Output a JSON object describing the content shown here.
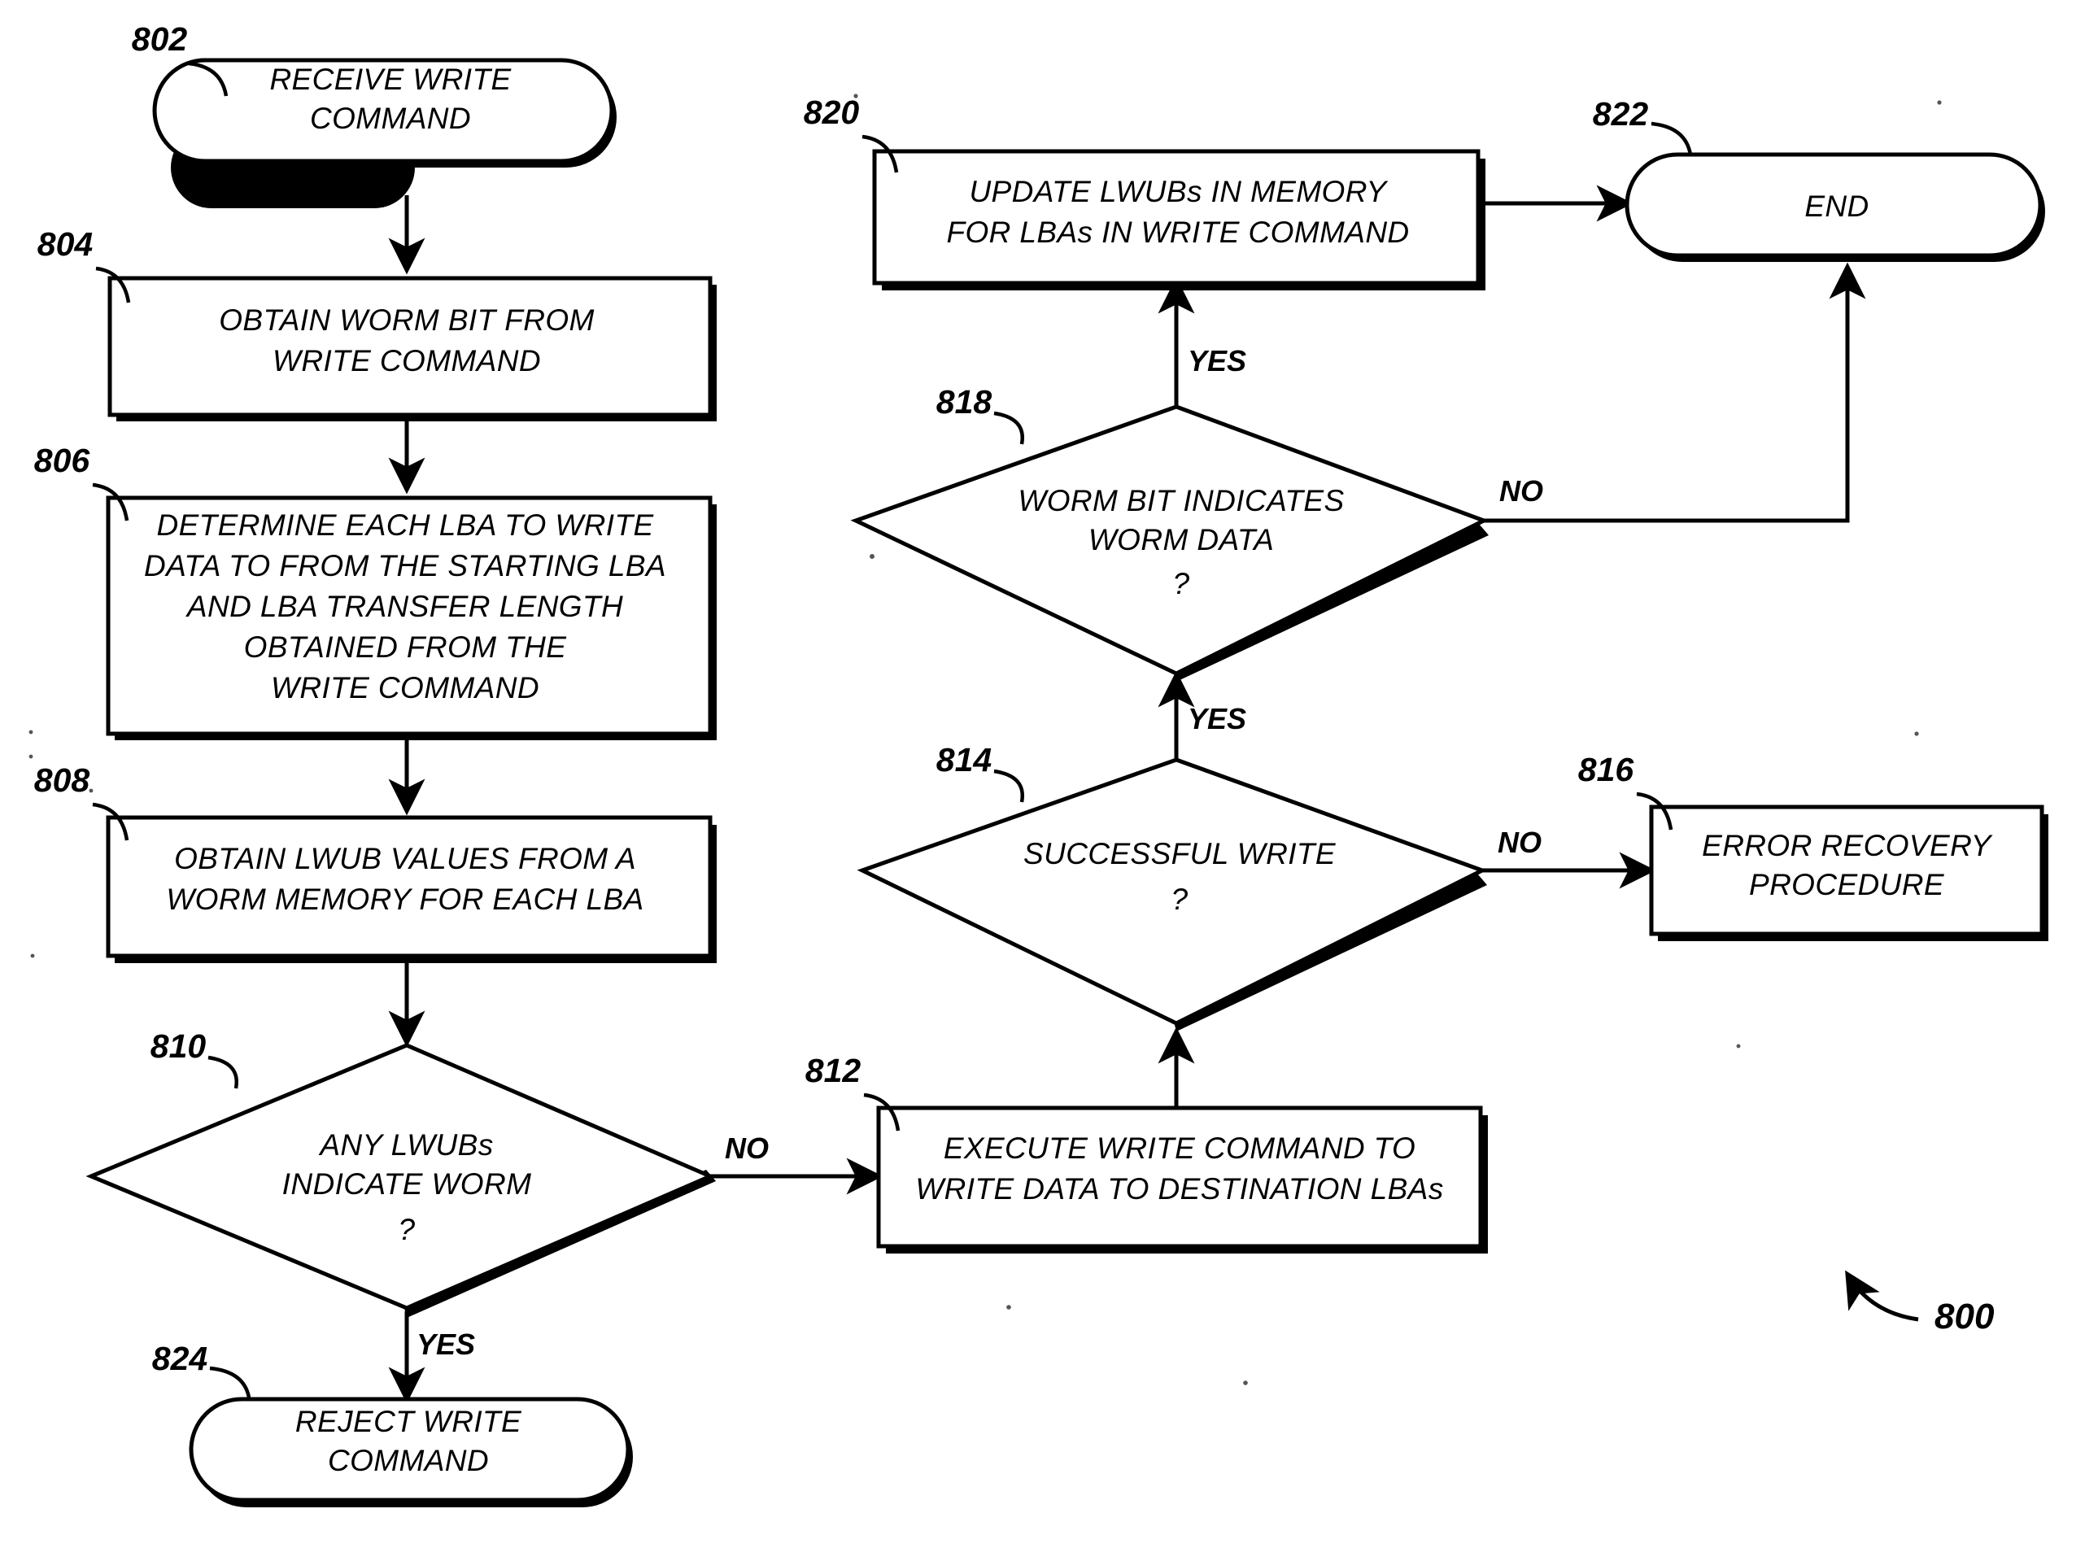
{
  "figure": {
    "number": "800",
    "title": "Write command WORM processing flowchart"
  },
  "nodes": [
    {
      "id": "802",
      "ref": "802",
      "shape": "terminator",
      "lines": [
        "RECEIVE WRITE",
        "COMMAND"
      ]
    },
    {
      "id": "804",
      "ref": "804",
      "shape": "process",
      "lines": [
        "OBTAIN WORM BIT FROM",
        "WRITE COMMAND"
      ]
    },
    {
      "id": "806",
      "ref": "806",
      "shape": "process",
      "lines": [
        "DETERMINE EACH LBA TO WRITE",
        "DATA TO FROM THE STARTING LBA",
        "AND LBA TRANSFER LENGTH",
        "OBTAINED FROM THE",
        "WRITE COMMAND"
      ]
    },
    {
      "id": "808",
      "ref": "808",
      "shape": "process",
      "lines": [
        "OBTAIN LWUB VALUES FROM A",
        "WORM MEMORY FOR EACH LBA"
      ]
    },
    {
      "id": "810",
      "ref": "810",
      "shape": "decision",
      "lines": [
        "ANY LWUBs",
        "INDICATE WORM",
        "?"
      ]
    },
    {
      "id": "812",
      "ref": "812",
      "shape": "process",
      "lines": [
        "EXECUTE WRITE COMMAND TO",
        "WRITE DATA TO DESTINATION LBAs"
      ]
    },
    {
      "id": "814",
      "ref": "814",
      "shape": "decision",
      "lines": [
        "SUCCESSFUL WRITE",
        "?"
      ]
    },
    {
      "id": "816",
      "ref": "816",
      "shape": "process",
      "lines": [
        "ERROR RECOVERY",
        "PROCEDURE"
      ]
    },
    {
      "id": "818",
      "ref": "818",
      "shape": "decision",
      "lines": [
        "WORM BIT INDICATES",
        "WORM DATA",
        "?"
      ]
    },
    {
      "id": "820",
      "ref": "820",
      "shape": "process",
      "lines": [
        "UPDATE LWUBs IN MEMORY",
        "FOR LBAs IN WRITE COMMAND"
      ]
    },
    {
      "id": "822",
      "ref": "822",
      "shape": "terminator",
      "lines": [
        "END"
      ]
    },
    {
      "id": "824",
      "ref": "824",
      "shape": "terminator",
      "lines": [
        "REJECT WRITE",
        "COMMAND"
      ]
    }
  ],
  "branch_labels": {
    "d810_no": "NO",
    "d810_yes": "YES",
    "d814_no": "NO",
    "d814_yes": "YES",
    "d818_no": "NO",
    "d818_yes": "YES"
  }
}
